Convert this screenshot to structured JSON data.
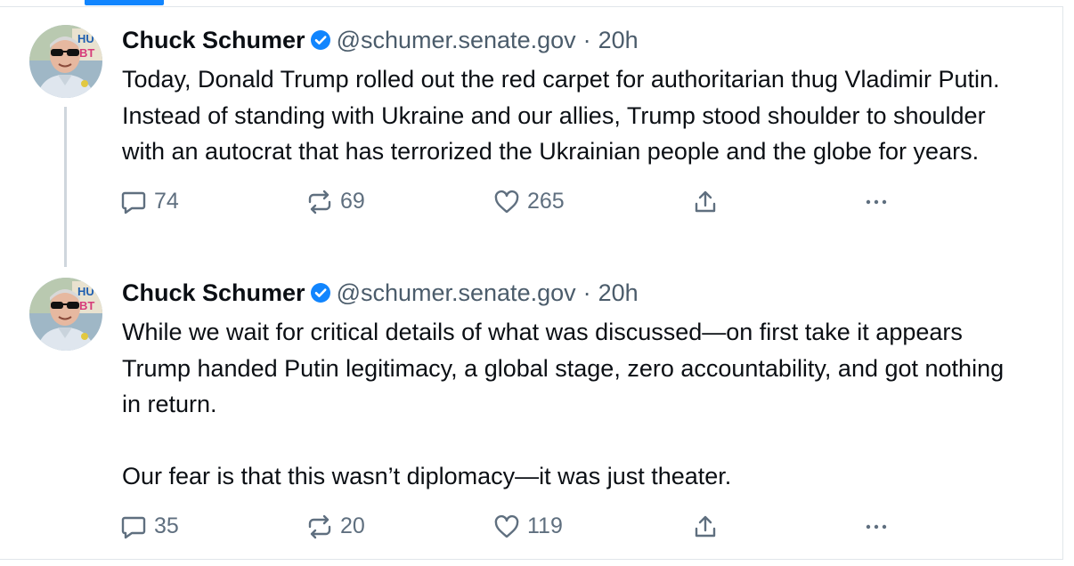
{
  "posts": [
    {
      "author": "Chuck Schumer",
      "handle": "@schumer.senate.gov",
      "separator": "·",
      "time": "20h",
      "paragraphs": [
        "Today, Donald Trump rolled out the red carpet for authoritarian thug Vladimir Putin. Instead of standing with Ukraine and our allies, Trump stood shoulder to shoulder with an autocrat that has terrorized the Ukrainian people and the globe for years."
      ],
      "replies": "74",
      "reposts": "69",
      "likes": "265"
    },
    {
      "author": "Chuck Schumer",
      "handle": "@schumer.senate.gov",
      "separator": "·",
      "time": "20h",
      "paragraphs": [
        "While we wait for critical details of what was discussed—on first take it appears Trump handed Putin legitimacy, a global stage, zero accountability, and got nothing in return.",
        "Our fear is that this wasn’t diplomacy—it was just theater."
      ],
      "replies": "35",
      "reposts": "20",
      "likes": "119"
    }
  ],
  "icons": {
    "verified": "verified-badge-icon",
    "reply": "speech-bubble-icon",
    "repost": "repost-arrows-icon",
    "like": "heart-icon",
    "share": "share-upload-icon",
    "more": "more-dots-icon"
  },
  "colors": {
    "accent": "#1185fe",
    "text": "#0b0f14",
    "muted": "#4b5c6b",
    "icon": "#5f6f7f",
    "thread_line": "#cfd6dd",
    "border": "#e1e6ea"
  }
}
